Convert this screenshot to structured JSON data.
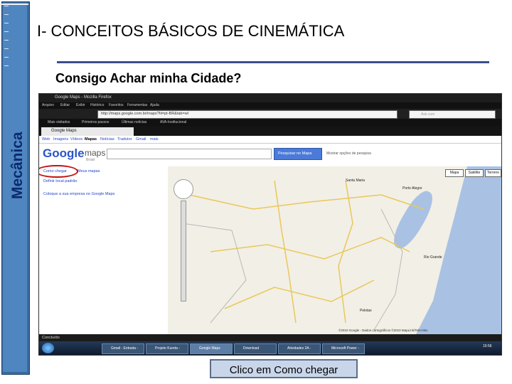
{
  "sidebar": {
    "label": "Mecânica"
  },
  "slide": {
    "title": "I- CONCEITOS BÁSICOS DE CINEMÁTICA",
    "subtitle": "Consigo Achar minha Cidade?",
    "caption": "Clico em Como chegar"
  },
  "browser": {
    "window_title": "Google Maps - Mozilla Firefox",
    "menu": [
      "Arquivo",
      "Editar",
      "Exibir",
      "Histórico",
      "Favoritos",
      "Ferramentas",
      "Ajuda"
    ],
    "url": "http://maps.google.com.br/maps?hl=pt-BR&tab=wl",
    "search_placeholder": "Ask.com",
    "bookmarks": [
      "Mais visitados",
      "Primeiros passos",
      "Últimas notícias",
      "AVA-Institucional"
    ],
    "tab_label": "Google Maps",
    "status": "Concluído"
  },
  "google": {
    "nav": [
      "Web",
      "Imagens",
      "Vídeos",
      "Mapas",
      "Notícias",
      "Tradutor",
      "Gmail",
      "mais"
    ],
    "logo": "Google",
    "logo_maps": "maps",
    "logo_country": "Brasil",
    "search_button": "Pesquisar no Mapa",
    "options": "Mostrar opções de pesquisa",
    "links": {
      "como_chegar": "Como chegar",
      "meus_mapas": "Meus mapas",
      "definir": "Definir local padrão",
      "coloque": "Coloque a sua empresa no Google Maps"
    },
    "map_buttons": [
      "Mapa",
      "Satélite",
      "Terreno"
    ],
    "map_cities": [
      "Santa Maria",
      "Porto Alegre",
      "Pelotas",
      "Rio Grande"
    ],
    "copyright": "©2010 Google - Dados cartográficos ©2010 MapLink/TeleAtlas"
  },
  "taskbar": {
    "items": [
      "Gmail - Entrada -",
      "Projeto Kureta -",
      "Google Maps",
      "Download",
      "Atividades 2A -",
      "Microsoft Power -"
    ],
    "clock": "15:56"
  }
}
